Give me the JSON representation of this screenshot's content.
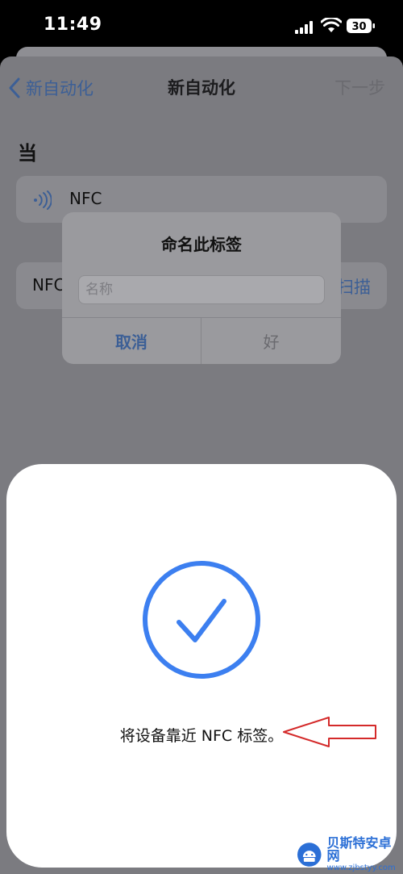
{
  "status_bar": {
    "time": "11:49",
    "battery": "30"
  },
  "nav": {
    "back_label": "新自动化",
    "title": "新自动化",
    "next_label": "下一步"
  },
  "section": {
    "label": "当"
  },
  "trigger": {
    "label": "NFC"
  },
  "scan_row": {
    "label": "NFC",
    "button_label": "扫描"
  },
  "alert": {
    "title": "命名此标签",
    "input_placeholder": "名称",
    "input_value": "",
    "cancel_label": "取消",
    "ok_label": "好"
  },
  "nfc_sheet": {
    "message": "将设备靠近 NFC 标签。"
  },
  "watermark": {
    "name": "贝斯特安卓网",
    "url": "www.zjbstyy.com"
  },
  "colors": {
    "accent": "#3c7ff0",
    "annotation": "#d42a2a",
    "link": "#3c5f96"
  },
  "icons": [
    "signal-icon",
    "wifi-icon",
    "battery-icon",
    "chevron-left-icon",
    "nfc-wave-icon",
    "checkmark-circle-icon"
  ]
}
